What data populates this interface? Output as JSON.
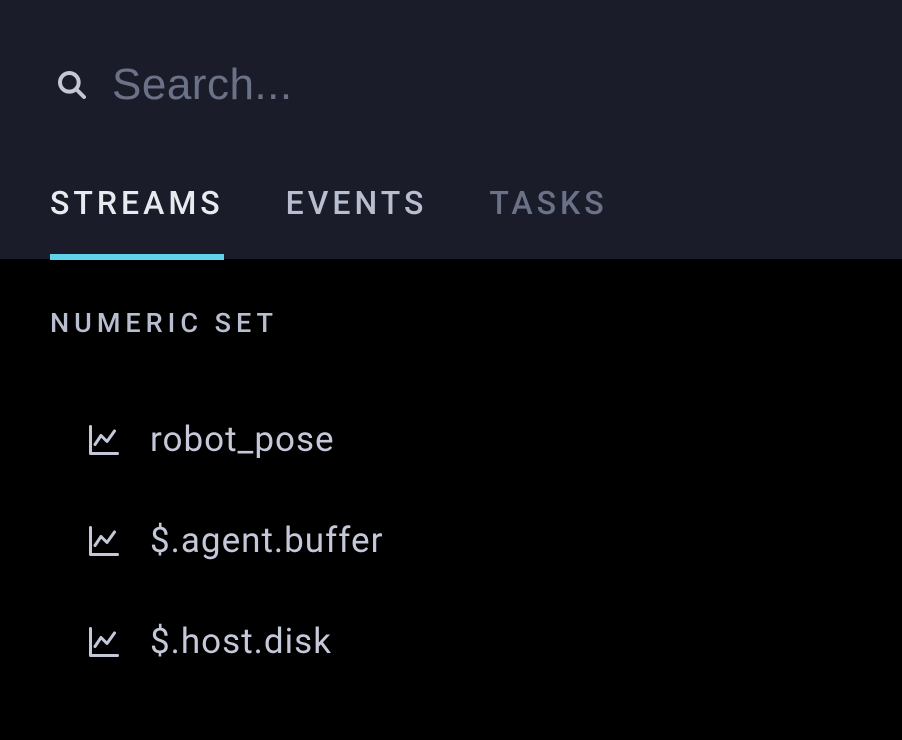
{
  "search": {
    "placeholder": "Search..."
  },
  "tabs": [
    {
      "label": "STREAMS",
      "active": true
    },
    {
      "label": "EVENTS",
      "active": false
    },
    {
      "label": "TASKS",
      "active": false
    }
  ],
  "section": {
    "header": "NUMERIC SET",
    "items": [
      {
        "label": "robot_pose"
      },
      {
        "label": "$.agent.buffer"
      },
      {
        "label": "$.host.disk"
      }
    ]
  }
}
